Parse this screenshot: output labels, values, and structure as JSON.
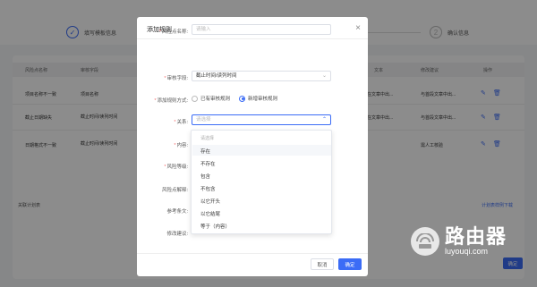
{
  "steps": {
    "step1": {
      "icon": "check-icon",
      "label": "填写模板信息"
    },
    "step2": {
      "icon": "number-2-icon",
      "number": "2",
      "label": "确认信息"
    }
  },
  "table": {
    "headers": [
      "风险点名称",
      "审核字段",
      "文本",
      "修改建议",
      "操作"
    ],
    "rows": [
      {
        "name": "项目名称不一致",
        "field": "项目名称",
        "text": "在文章中出...",
        "suggest": "与首段文章中出..."
      },
      {
        "name": "截止日期缺失",
        "field": "截止时间/读列时间",
        "text": "在文章中出...",
        "suggest": "与首段文章中出..."
      },
      {
        "name": "日期格式不一致",
        "field": "截止时间/读列时间",
        "text": "",
        "suggest": "需人工核验"
      }
    ],
    "section_left": "关联计划表",
    "section_right": "计划表样例下载",
    "bottom_button": "确定"
  },
  "modal": {
    "title": "添加规则",
    "close": "×",
    "fields": {
      "name": {
        "label": "风险点名称:",
        "placeholder": "请输入"
      },
      "audit_field": {
        "label": "审核字段:",
        "value": "截止时间/读列时间"
      },
      "add_method": {
        "label": "添加规则方式:",
        "options": [
          "已有审核规则",
          "新增审核规则"
        ],
        "selected": 1
      },
      "relation": {
        "label": "关系:",
        "placeholder": "请选择"
      },
      "content": {
        "label": "内容:"
      },
      "risk_level": {
        "label": "风险等级:"
      },
      "risk_explain": {
        "label": "风险点解释:"
      },
      "reference": {
        "label": "参考条文:"
      },
      "suggest": {
        "label": "修改建议:"
      }
    },
    "dropdown": {
      "hint": "请选择",
      "options": [
        "存在",
        "不存在",
        "包含",
        "不包含",
        "以它开头",
        "以它结尾",
        "等于（内容）"
      ],
      "highlighted": 0
    },
    "buttons": {
      "cancel": "取消",
      "ok": "确定"
    }
  },
  "watermark": {
    "cn": "路由器",
    "en": "luyouqi.com"
  },
  "colors": {
    "accent": "#3b6cf6",
    "required": "#f56c6c"
  }
}
